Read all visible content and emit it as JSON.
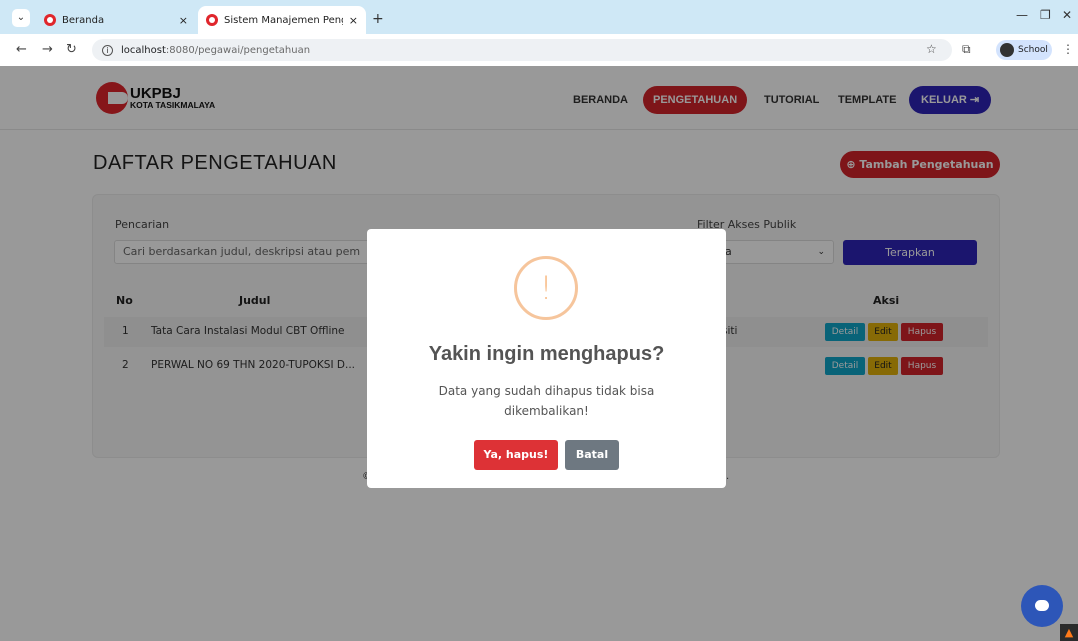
{
  "browser": {
    "tabs": [
      {
        "label": "Beranda",
        "close": "×"
      },
      {
        "label": "Sistem Manajemen Pengetahua",
        "close": "×"
      }
    ],
    "new_tab": "+",
    "url_host": "localhost",
    "url_path": ":8080/pegawai/pengetahuan",
    "profile": "School"
  },
  "logo": {
    "line1": "UKPBJ",
    "line2": "KOTA TASIKMALAYA"
  },
  "nav": {
    "beranda": "BERANDA",
    "pengetahuan": "PENGETAHUAN",
    "tutorial": "TUTORIAL",
    "template": "TEMPLATE",
    "keluar": "KELUAR ⇥"
  },
  "page": {
    "title": "DAFTAR PENGETAHUAN",
    "add_button": "⊕ Tambah Pengetahuan",
    "search_label": "Pencarian",
    "search_placeholder": "Cari berdasarkan judul, deskripsi atau pem",
    "filter_label": "Filter Akses Publik",
    "filter_value": "nua",
    "apply_button": "Terapkan",
    "footer_left": "©",
    "footer_right": "."
  },
  "table": {
    "headers": {
      "no": "No",
      "judul": "Judul",
      "aksi": "Aksi"
    },
    "rows": [
      {
        "no": "1",
        "judul": "Tata Cara Instalasi Modul CBT Offline",
        "extra": "siti",
        "detail": "Detail",
        "edit": "Edit",
        "hapus": "Hapus"
      },
      {
        "no": "2",
        "judul": "PERWAL NO 69 THN 2020-TUPOKSI D...",
        "extra": "",
        "detail": "Detail",
        "edit": "Edit",
        "hapus": "Hapus"
      }
    ]
  },
  "modal": {
    "icon": "!",
    "title": "Yakin ingin menghapus?",
    "text": "Data yang sudah dihapus tidak bisa dikembalikan!",
    "confirm": "Ya, hapus!",
    "cancel": "Batal"
  }
}
